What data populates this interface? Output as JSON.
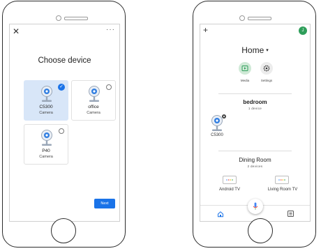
{
  "left_screen": {
    "close_icon": "close-icon",
    "more_icon": "more-horizontal-icon",
    "close_glyph": "✕",
    "more_glyph": "···",
    "title": "Choose device",
    "devices": [
      {
        "name": "C5300",
        "type": "Camera",
        "selected": true
      },
      {
        "name": "office",
        "type": "Camera",
        "selected": false
      },
      {
        "name": "P40",
        "type": "Camera",
        "selected": false
      }
    ],
    "next_label": "Next",
    "colors": {
      "accent": "#1a73e8",
      "selected_bg": "#d8e6f8"
    }
  },
  "right_screen": {
    "add_glyph": "+",
    "avatar_letter": "J",
    "title": "Home",
    "caret": "▾",
    "actions": [
      {
        "label": "Media",
        "icon": "play-icon"
      },
      {
        "label": "Settings",
        "icon": "gear-icon"
      }
    ],
    "rooms": [
      {
        "name": "bedroom",
        "subtitle": "1 device",
        "devices": [
          "C5300"
        ]
      },
      {
        "name": "Dining Room",
        "subtitle": "2 devices",
        "devices": [
          "Android TV",
          "Living Room TV"
        ]
      }
    ],
    "nav": [
      "home-icon",
      "mic-icon",
      "list-icon"
    ],
    "colors": {
      "avatar": "#2e9e5a",
      "media_bg": "#cfe9d6",
      "settings_bg": "#ececec"
    }
  }
}
